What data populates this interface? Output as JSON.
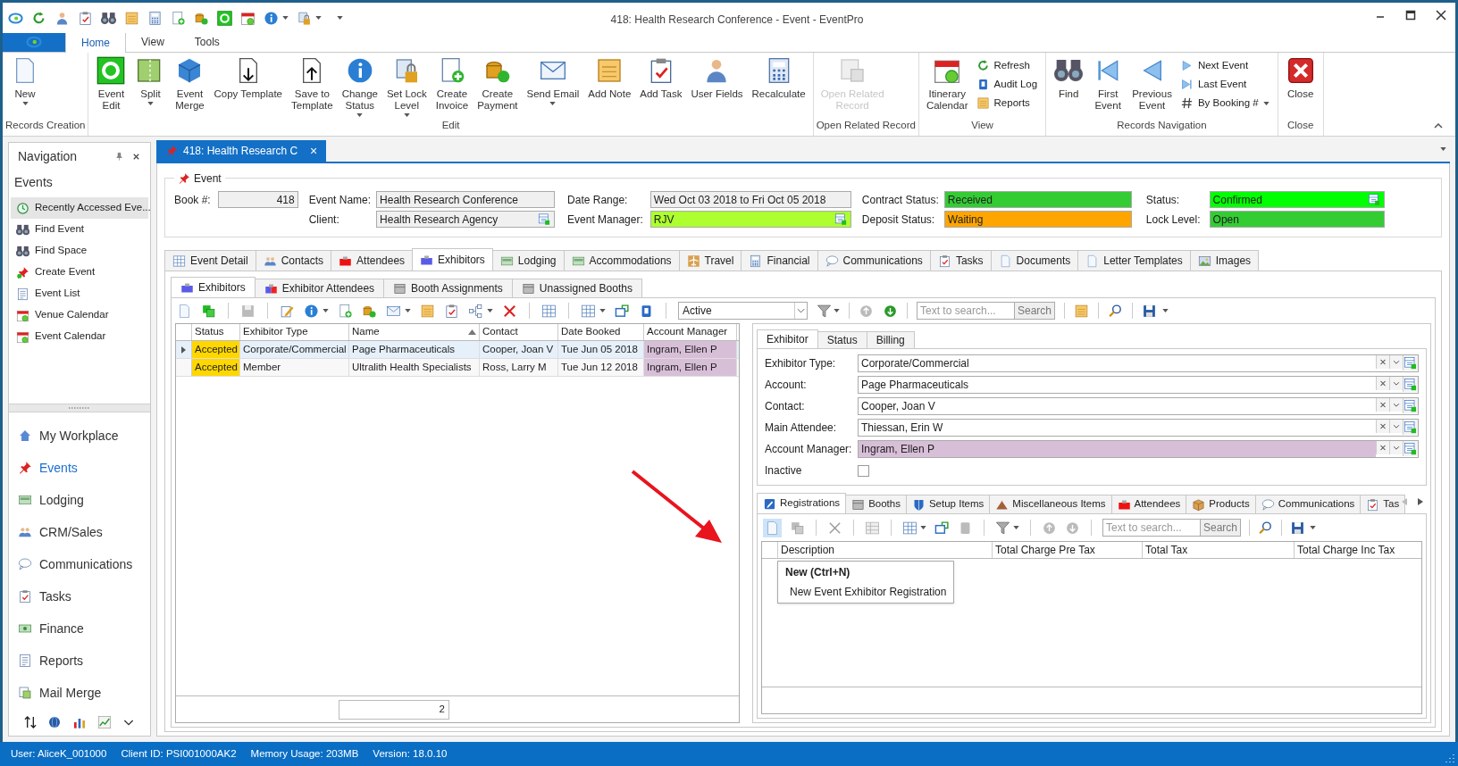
{
  "window": {
    "title": "418: Health Research Conference - Event - EventPro"
  },
  "ribbon_tabs": [
    {
      "label": "Home",
      "selected": true
    },
    {
      "label": "View",
      "selected": false
    },
    {
      "label": "Tools",
      "selected": false
    }
  ],
  "ribbon_groups": [
    {
      "label": "Records Creation",
      "buttons": [
        {
          "label": "New",
          "dropdown": true,
          "disabled": false
        }
      ]
    },
    {
      "label": "Edit",
      "buttons": [
        {
          "label": "Event\nEdit",
          "dropdown": false,
          "disabled": false
        },
        {
          "label": "Split",
          "dropdown": true,
          "disabled": false
        },
        {
          "label": "Event\nMerge",
          "dropdown": false,
          "disabled": false
        },
        {
          "label": "Copy Template",
          "dropdown": false,
          "disabled": false
        },
        {
          "label": "Save to\nTemplate",
          "dropdown": false,
          "disabled": false
        },
        {
          "label": "Change\nStatus",
          "dropdown": true,
          "disabled": false
        },
        {
          "label": "Set Lock\nLevel",
          "dropdown": true,
          "disabled": false
        },
        {
          "label": "Create\nInvoice",
          "dropdown": false,
          "disabled": false
        },
        {
          "label": "Create\nPayment",
          "dropdown": false,
          "disabled": false
        },
        {
          "label": "Send Email",
          "dropdown": true,
          "disabled": false
        },
        {
          "label": "Add Note",
          "dropdown": false,
          "disabled": false
        },
        {
          "label": "Add Task",
          "dropdown": false,
          "disabled": false
        },
        {
          "label": "User Fields",
          "dropdown": false,
          "disabled": false
        },
        {
          "label": "Recalculate",
          "dropdown": false,
          "disabled": false
        }
      ]
    },
    {
      "label": "Open Related Record",
      "buttons": [
        {
          "label": "Open Related\nRecord",
          "dropdown": false,
          "disabled": true
        }
      ]
    },
    {
      "label": "View",
      "buttons": [
        {
          "label": "Itinerary\nCalendar",
          "dropdown": false,
          "disabled": false
        }
      ],
      "small_buttons": [
        {
          "label": "Refresh",
          "dropdown": false
        },
        {
          "label": "Audit Log",
          "dropdown": false
        },
        {
          "label": "Reports",
          "dropdown": false
        }
      ]
    },
    {
      "label": "Records Navigation",
      "buttons": [
        {
          "label": "Find",
          "dropdown": false,
          "disabled": false
        },
        {
          "label": "First\nEvent",
          "dropdown": false,
          "disabled": false
        },
        {
          "label": "Previous\nEvent",
          "dropdown": false,
          "disabled": false
        }
      ],
      "small_buttons": [
        {
          "label": "Next Event",
          "dropdown": false
        },
        {
          "label": "Last Event",
          "dropdown": false
        },
        {
          "label": "By Booking #",
          "dropdown": true
        }
      ]
    },
    {
      "label": "Close",
      "buttons": [
        {
          "label": "Close",
          "dropdown": false,
          "disabled": false
        }
      ]
    }
  ],
  "navigation": {
    "title": "Navigation",
    "section": "Events",
    "items": [
      {
        "label": "Recently Accessed Eve...",
        "selected": true
      },
      {
        "label": "Find Event",
        "selected": false
      },
      {
        "label": "Find Space",
        "selected": false
      },
      {
        "label": "Create Event",
        "selected": false
      },
      {
        "label": "Event List",
        "selected": false
      },
      {
        "label": "Venue Calendar",
        "selected": false
      },
      {
        "label": "Event Calendar",
        "selected": false
      }
    ],
    "modules": [
      {
        "label": "My Workplace",
        "selected": false
      },
      {
        "label": "Events",
        "selected": true
      },
      {
        "label": "Lodging",
        "selected": false
      },
      {
        "label": "CRM/Sales",
        "selected": false
      },
      {
        "label": "Communications",
        "selected": false
      },
      {
        "label": "Tasks",
        "selected": false
      },
      {
        "label": "Finance",
        "selected": false
      },
      {
        "label": "Reports",
        "selected": false
      },
      {
        "label": "Mail Merge",
        "selected": false
      }
    ]
  },
  "document_tab": {
    "label": "418: Health Research C",
    "close": "×"
  },
  "event": {
    "legend": "Event",
    "fields": [
      {
        "label": "Book #:",
        "value": "418"
      },
      {
        "label": "Event Name:",
        "value": "Health Research Conference"
      },
      {
        "label": "Client:",
        "value": "Health Research Agency"
      },
      {
        "label": "Date Range:",
        "value": "Wed Oct 03 2018 to Fri Oct 05 2018"
      },
      {
        "label": "Event Manager:",
        "value": "RJV",
        "color": "#adff2f"
      },
      {
        "label": "Contract Status:",
        "value": "Received",
        "color": "#33cc33"
      },
      {
        "label": "Deposit Status:",
        "value": "Waiting",
        "color": "#ffa500"
      },
      {
        "label": "Status:",
        "value": "Confirmed",
        "color": "#00ff00"
      },
      {
        "label": "Lock Level:",
        "value": "Open",
        "color": "#33cc33"
      }
    ]
  },
  "main_tabs": [
    {
      "label": "Event Detail",
      "selected": false
    },
    {
      "label": "Contacts",
      "selected": false
    },
    {
      "label": "Attendees",
      "selected": false
    },
    {
      "label": "Exhibitors",
      "selected": true
    },
    {
      "label": "Lodging",
      "selected": false
    },
    {
      "label": "Accommodations",
      "selected": false
    },
    {
      "label": "Travel",
      "selected": false
    },
    {
      "label": "Financial",
      "selected": false
    },
    {
      "label": "Communications",
      "selected": false
    },
    {
      "label": "Tasks",
      "selected": false
    },
    {
      "label": "Documents",
      "selected": false
    },
    {
      "label": "Letter Templates",
      "selected": false
    },
    {
      "label": "Images",
      "selected": false
    }
  ],
  "sub_tabs": [
    {
      "label": "Exhibitors",
      "selected": true
    },
    {
      "label": "Exhibitor Attendees",
      "selected": false
    },
    {
      "label": "Booth Assignments",
      "selected": false
    },
    {
      "label": "Unassigned Booths",
      "selected": false
    }
  ],
  "toolbar": {
    "filter": "Active",
    "search_placeholder": "Text to search...",
    "search_button": "Search"
  },
  "exhibitors_table": {
    "columns": [
      {
        "label": "Status",
        "sorted": false
      },
      {
        "label": "Exhibitor Type",
        "sorted": false
      },
      {
        "label": "Name",
        "sorted": true
      },
      {
        "label": "Contact",
        "sorted": false
      },
      {
        "label": "Date Booked",
        "sorted": false
      },
      {
        "label": "Account Manager",
        "sorted": false
      }
    ],
    "rows": [
      {
        "selected": true,
        "cells": [
          {
            "text": "Accepted",
            "color": "#ffd700"
          },
          {
            "text": "Corporate/Commercial"
          },
          {
            "text": "Page Pharmaceuticals"
          },
          {
            "text": "Cooper, Joan V"
          },
          {
            "text": "Tue Jun 05 2018"
          },
          {
            "text": "Ingram, Ellen P",
            "color": "#d8bfd8"
          }
        ]
      },
      {
        "selected": false,
        "cells": [
          {
            "text": "Accepted",
            "color": "#ffd700"
          },
          {
            "text": "Member"
          },
          {
            "text": "Ultralith Health Specialists"
          },
          {
            "text": "Ross, Larry M"
          },
          {
            "text": "Tue Jun 12 2018"
          },
          {
            "text": "Ingram, Ellen P",
            "color": "#d8bfd8"
          }
        ]
      }
    ],
    "count": "2"
  },
  "detail_tabs": [
    {
      "label": "Exhibitor",
      "selected": true
    },
    {
      "label": "Status",
      "selected": false
    },
    {
      "label": "Billing",
      "selected": false
    }
  ],
  "detail_fields": [
    {
      "label": "Exhibitor Type:",
      "value": "Corporate/Commercial"
    },
    {
      "label": "Account:",
      "value": "Page Pharmaceuticals"
    },
    {
      "label": "Contact:",
      "value": "Cooper, Joan V"
    },
    {
      "label": "Main Attendee:",
      "value": "Thiessan, Erin W"
    },
    {
      "label": "Account Manager:",
      "value": "Ingram, Ellen P",
      "color": "#d8bfd8"
    }
  ],
  "inactive": {
    "label": "Inactive",
    "checked": false
  },
  "bottom_tabs": [
    {
      "label": "Registrations",
      "selected": true
    },
    {
      "label": "Booths",
      "selected": false
    },
    {
      "label": "Setup Items",
      "selected": false
    },
    {
      "label": "Miscellaneous Items",
      "selected": false
    },
    {
      "label": "Attendees",
      "selected": false
    },
    {
      "label": "Products",
      "selected": false
    },
    {
      "label": "Communications",
      "selected": false
    },
    {
      "label": "Tas",
      "selected": false
    }
  ],
  "bottom_toolbar": {
    "search_placeholder": "Text to search...",
    "search_button": "Search"
  },
  "registrations_table": {
    "columns": [
      "Description",
      "Total Charge Pre Tax",
      "Total Tax",
      "Total Charge Inc Tax"
    ]
  },
  "tooltip": {
    "title": "New (Ctrl+N)",
    "text": "New Event Exhibitor Registration"
  },
  "status_bar": [
    "User: AliceK_001000",
    "Client ID: PSI001000AK2",
    "Memory Usage: 203MB",
    "Version: 18.0.10"
  ]
}
